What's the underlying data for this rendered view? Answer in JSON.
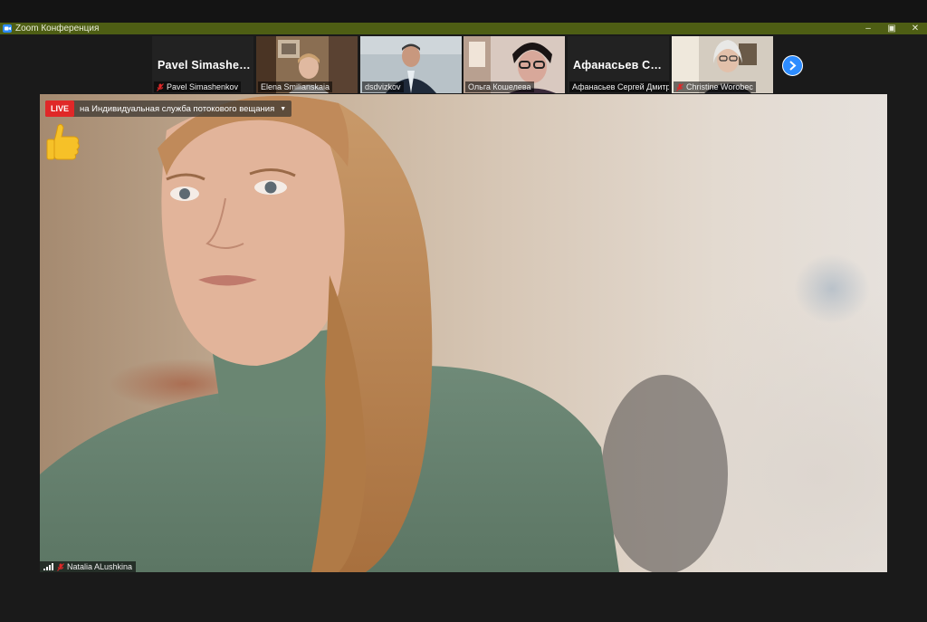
{
  "window": {
    "title": "Zoom Конференция",
    "minimize": "–",
    "maximize": "▣",
    "close": "✕"
  },
  "participants": [
    {
      "name_large": "Pavel  Simashen...",
      "caption": "Pavel Simashenkov",
      "video": false,
      "muted": true
    },
    {
      "caption": "Elena Smilianskaia",
      "video": true,
      "muted": false
    },
    {
      "caption": "dsdvizkov",
      "video": true,
      "muted": false
    },
    {
      "caption": "Ольга Кошелева",
      "video": true,
      "muted": false
    },
    {
      "name_large": "Афанасьев  Сер...",
      "caption": "Афанасьев Сергей Дмитр...",
      "video": false,
      "muted": false
    },
    {
      "caption": "Christine Worobec",
      "video": true,
      "muted": true
    }
  ],
  "live": {
    "badge": "LIVE",
    "text": "на Индивидуальная служба потокового вещания"
  },
  "reaction": "thumbs-up",
  "active_speaker": {
    "name": "Natalia ALushkina",
    "muted": true
  },
  "colors": {
    "title_bar": "#4e5e14",
    "accent": "#2d8cff",
    "live": "#e02828",
    "mute": "#e02828"
  }
}
